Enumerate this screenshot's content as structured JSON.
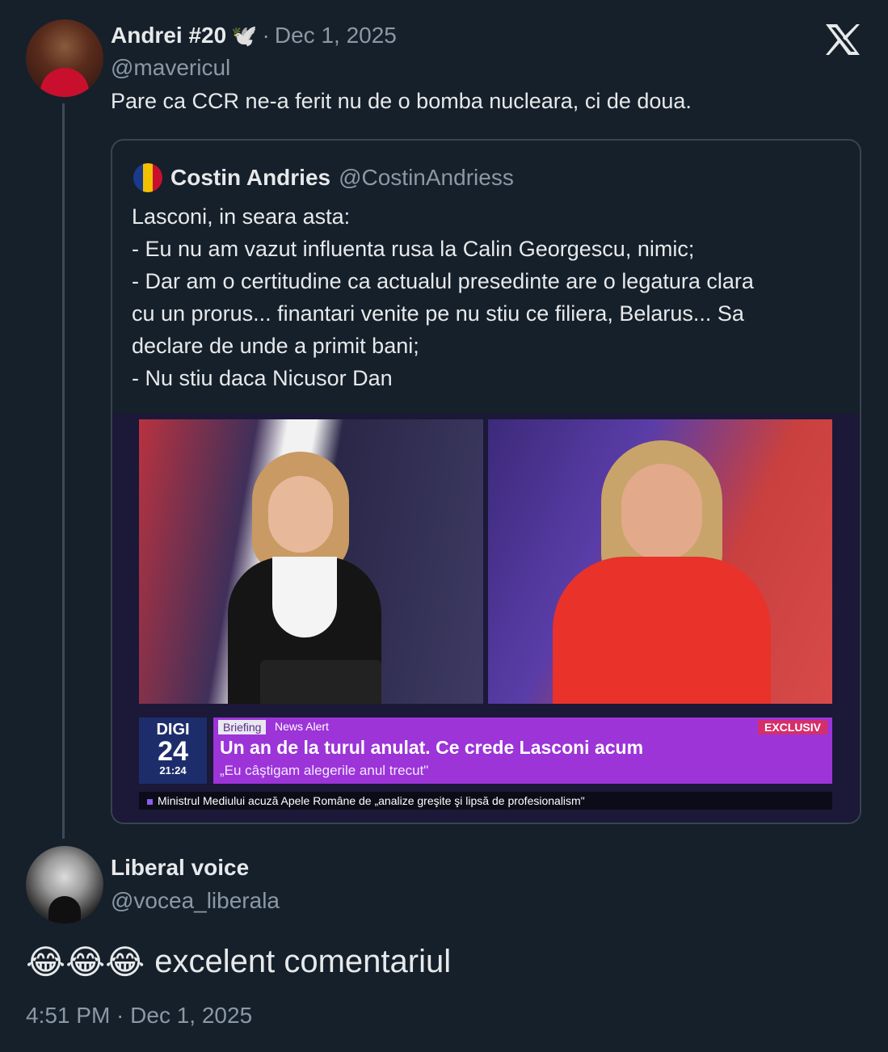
{
  "parent_post": {
    "author_name": "Andrei #20",
    "author_emoji": "🕊️",
    "separator": "·",
    "date": "Dec 1, 2025",
    "handle": "@mavericul",
    "text": "Pare ca CCR ne-a ferit nu de o bomba nucleara, ci de doua."
  },
  "quoted_post": {
    "author_name": "Costin Andries",
    "handle": "@CostinAndriess",
    "lines": [
      "Lasconi, in seara asta:",
      "- Eu nu am vazut influenta rusa la Calin Georgescu, nimic;",
      "- Dar am o certitudine ca actualul presedinte are o legatura clara",
      "cu un prorus... finantari venite pe nu stiu ce filiera, Belarus... Sa",
      "declare de unde a primit bani;",
      "- Nu stiu daca Nicusor Dan"
    ],
    "media": {
      "logo_top": "DIGI",
      "logo_num": "24",
      "time": "21:24",
      "tag_briefing": "Briefing",
      "tag_alert": "News Alert",
      "tag_exclusive": "EXCLUSIV",
      "headline": "Un an de la turul anulat. Ce crede Lasconi acum",
      "subheadline": "„Eu câştigam alegerile anul trecut\"",
      "ticker": "Ministrul Mediului acuză Apele Române de „analize greşite şi lipsă de profesionalism\""
    }
  },
  "reply_post": {
    "author_name": "Liberal voice",
    "handle": "@vocea_liberala",
    "emojis": "😂😂😂",
    "text": "excelent comentariul",
    "timestamp": "4:51 PM · Dec 1, 2025"
  },
  "brand": {
    "logo": "x-logo-icon"
  },
  "colors": {
    "background": "#15202b",
    "text": "#e7e9ea",
    "muted": "#8b98a5",
    "accent_purple": "#9c34d8"
  }
}
